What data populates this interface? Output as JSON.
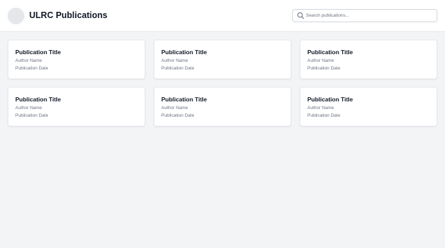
{
  "header": {
    "title": "ULRC Publications",
    "search": {
      "placeholder": "Search publications...",
      "value": ""
    }
  },
  "publications": [
    {
      "title": "Publication Title",
      "author": "Author Name",
      "date": "Publication Date"
    },
    {
      "title": "Publication Title",
      "author": "Author Name",
      "date": "Publication Date"
    },
    {
      "title": "Publication Title",
      "author": "Author Name",
      "date": "Publication Date"
    },
    {
      "title": "Publication Title",
      "author": "Author Name",
      "date": "Publication Date"
    },
    {
      "title": "Publication Title",
      "author": "Author Name",
      "date": "Publication Date"
    },
    {
      "title": "Publication Title",
      "author": "Author Name",
      "date": "Publication Date"
    }
  ],
  "icons": {
    "logo": "logo-placeholder",
    "search": "search-icon"
  },
  "colors": {
    "background": "#f3f4f6",
    "card": "#ffffff",
    "muted_text": "#6b7280"
  }
}
